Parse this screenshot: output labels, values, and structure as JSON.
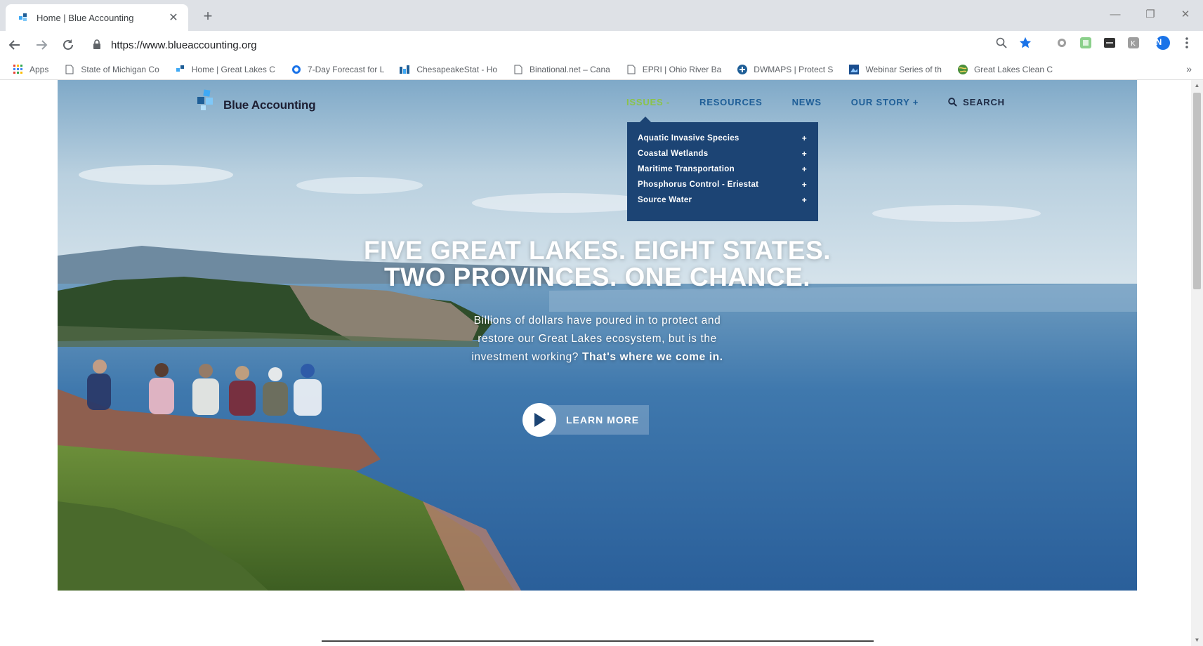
{
  "browser": {
    "tab_title": "Home | Blue Accounting",
    "url": "https://www.blueaccounting.org",
    "profile_initial": "N",
    "bookmarks": [
      "Apps",
      "State of Michigan Co",
      "Home | Great Lakes C",
      "7-Day Forecast for L",
      "ChesapeakeStat - Ho",
      "Binational.net – Cana",
      "EPRI | Ohio River Ba",
      "DWMAPS | Protect S",
      "Webinar Series of th",
      "Great Lakes Clean C"
    ]
  },
  "site": {
    "logo_text": "Blue Accounting",
    "nav": {
      "issues": "ISSUES -",
      "resources": "RESOURCES",
      "news": "NEWS",
      "our_story": "OUR STORY +",
      "search": "SEARCH"
    },
    "issues_menu": [
      "Aquatic Invasive Species",
      "Coastal Wetlands",
      "Maritime Transportation",
      "Phosphorus Control - Eriestat",
      "Source Water"
    ],
    "menu_plus": "+",
    "hero": {
      "headline_line1": "FIVE GREAT LAKES. EIGHT STATES.",
      "headline_line2": "TWO PROVINCES. ONE CHANCE.",
      "sub_line1": "Billions of dollars have poured in to protect and",
      "sub_line2": "restore our Great Lakes ecosystem, but is the",
      "sub_line3": "investment working?",
      "sub_bold": "That's where we come in.",
      "cta_label": "LEARN MORE"
    }
  },
  "colors": {
    "nav_blue": "#1e5e97",
    "nav_active": "#8bc34a",
    "dropdown_bg": "#1c4474",
    "chrome_bg": "#dee1e6"
  }
}
